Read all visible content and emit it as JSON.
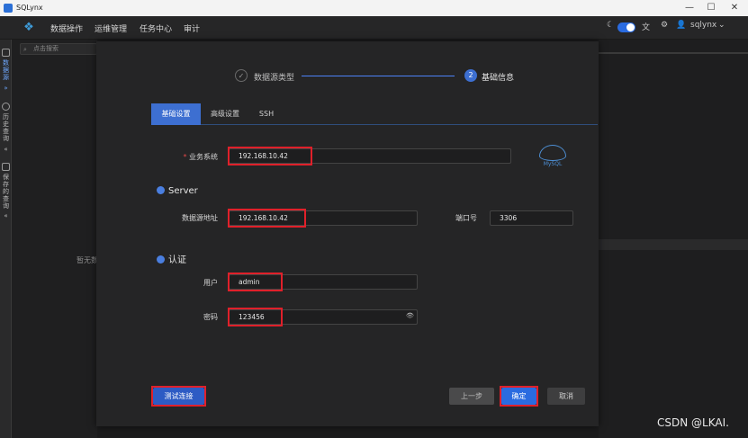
{
  "window": {
    "title": "SQLynx",
    "minimize": "—",
    "maximize": "☐",
    "close": "✕"
  },
  "topnav": {
    "items": [
      "数据操作",
      "运维管理",
      "任务中心",
      "审计"
    ],
    "user": "sqlynx",
    "moon_icon": "☾",
    "settings_icon": "⚙",
    "user_icon": "👤",
    "chevron": "⌄",
    "translate_icon": "文"
  },
  "leftbar": {
    "datasource": "数据源",
    "history": "历史查询",
    "saved": "保存的查询",
    "collapse": "«",
    "expand": "»"
  },
  "sidepanel": {
    "search_placeholder": "点击搜索",
    "empty_text": "暂无数"
  },
  "modal": {
    "steps": [
      {
        "icon": "✓",
        "label": "数据源类型"
      },
      {
        "number": "2",
        "label": "基础信息"
      }
    ],
    "tabs": [
      "基础设置",
      "高级设置",
      "SSH"
    ],
    "fields": {
      "business_system_label": "业务系统",
      "business_system_value": "192.168.10.42",
      "required_mark": "*",
      "server_section": "Server",
      "host_label": "数据源地址",
      "host_value": "192.168.10.42",
      "port_label": "端口号",
      "port_value": "3306",
      "auth_section": "认证",
      "user_label": "用户",
      "user_value": "admin",
      "password_label": "密码",
      "password_value": "123456",
      "eye_icon": "👁"
    },
    "logo_text": "MySQL",
    "buttons": {
      "test": "测试连接",
      "prev": "上一步",
      "ok": "确定",
      "cancel": "取消"
    }
  },
  "watermark": "CSDN @LKAI.",
  "colors": {
    "accent": "#2a6be0",
    "highlight": "#e0202a"
  }
}
